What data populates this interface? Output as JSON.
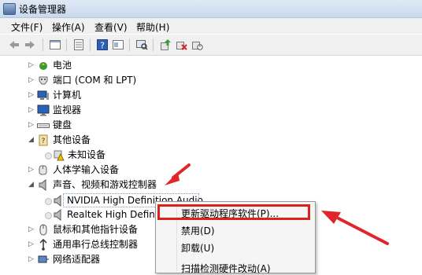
{
  "window": {
    "title": "设备管理器"
  },
  "menu": [
    "文件(F)",
    "操作(A)",
    "查看(V)",
    "帮助(H)"
  ],
  "toolbar": {
    "icons": [
      "back-icon",
      "forward-icon",
      "properties-icon",
      "list-icon",
      "help-icon",
      "details-icon",
      "scan-icon",
      "update-driver-icon",
      "uninstall-icon",
      "enable-icon"
    ]
  },
  "tree": {
    "battery": "电池",
    "ports": "端口 (COM 和 LPT)",
    "computer": "计算机",
    "monitor": "监视器",
    "keyboard": "键盘",
    "other": "其他设备",
    "unknown": "未知设备",
    "hid": "人体学输入设备",
    "audio": "声音、视频和游戏控制器",
    "nvidia": "NVIDIA High Definition Audio",
    "realtek": "Realtek High Definiti",
    "mouse": "鼠标和其他指针设备",
    "usb": "通用串行总线控制器",
    "network": "网络适配器"
  },
  "context_menu": {
    "update": "更新驱动程序软件(P)...",
    "disable": "禁用(D)",
    "uninstall": "卸载(U)",
    "scan": "扫描检测硬件改动(A)"
  },
  "colors": {
    "annotation": "#e0262a",
    "selection_border": "#7f9db9",
    "titlebar": "#c9d9ee"
  }
}
